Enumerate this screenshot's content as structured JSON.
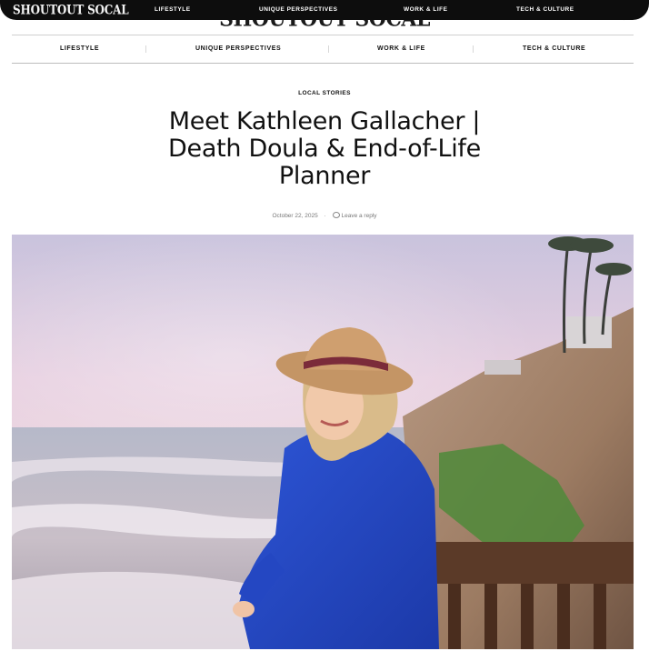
{
  "topbar": {
    "logo": "SHOUTOUT SOCAL",
    "nav": [
      "LIFESTYLE",
      "UNIQUE PERSPECTIVES",
      "WORK & LIFE",
      "TECH & CULTURE"
    ]
  },
  "masthead": {
    "logo": "SHOUTOUT SOCAL"
  },
  "mainnav": {
    "items": [
      "LIFESTYLE",
      "UNIQUE PERSPECTIVES",
      "WORK & LIFE",
      "TECH & CULTURE"
    ]
  },
  "article": {
    "category": "LOCAL STORIES",
    "title": "Meet Kathleen Gallacher | Death Doula & End-of-Life Planner",
    "date": "October 22, 2025",
    "separator": "·",
    "reply": "Leave a reply"
  },
  "icons": {
    "search": "search-icon",
    "comment": "comment-icon"
  }
}
